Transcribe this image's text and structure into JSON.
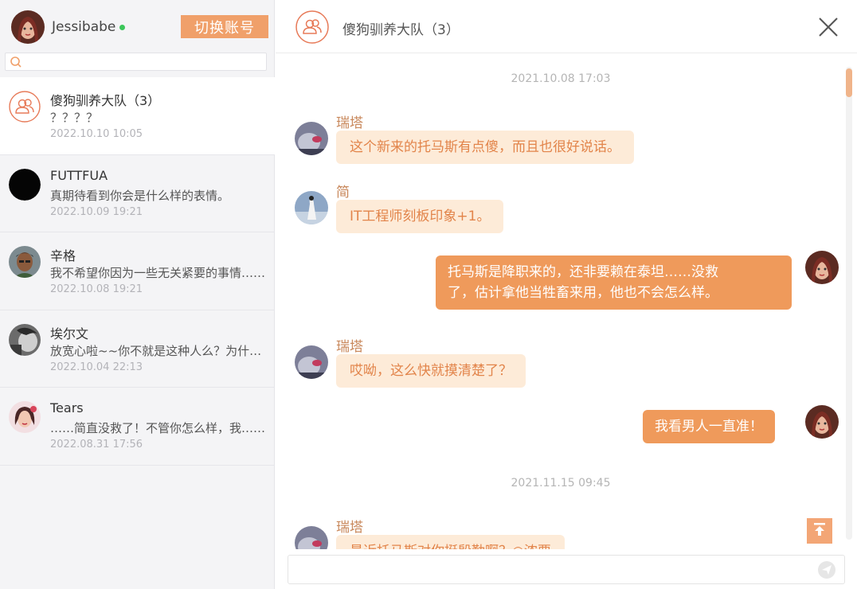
{
  "account": {
    "name": "Jessibabe",
    "switch_label": "切换账号"
  },
  "search": {
    "placeholder": ""
  },
  "conversations": [
    {
      "name": "傻狗驯养大队（3）",
      "last": "？？？？",
      "time": "2022.10.10 10:05"
    },
    {
      "name": "FUTTFUA",
      "last": "真期待看到你会是什么样的表情。",
      "time": "2022.10.09 19:21"
    },
    {
      "name": "辛格",
      "last": "我不希望你因为一些无关紧要的事情……",
      "time": "2022.10.08 19:21"
    },
    {
      "name": "埃尔文",
      "last": "放宽心啦~~你不就是这种人么？为什么……",
      "time": "2022.10.04 22:13"
    },
    {
      "name": "Tears",
      "last": "……简直没救了！不管你怎么样，我……",
      "time": "2022.08.31 17:56"
    }
  ],
  "chat": {
    "title": "傻狗驯养大队（3）",
    "timestamps": [
      "2021.10.08 17:03",
      "2021.11.15 09:45"
    ],
    "messages": [
      {
        "sender": "瑞塔",
        "text": "这个新来的托马斯有点傻，而且也很好说话。"
      },
      {
        "sender": "简",
        "text": "IT工程师刻板印象+1。"
      },
      {
        "sender": "me",
        "line1": "托马斯是降职来的，还非要赖在泰坦……没救",
        "line2": "了，估计拿他当牲畜来用，他也不会怎么样。"
      },
      {
        "sender": "瑞塔",
        "text": "哎呦，这么快就摸清楚了？"
      },
      {
        "sender": "me",
        "text": "我看男人一直准！"
      },
      {
        "sender": "瑞塔",
        "text": "最近托马斯对你挺殷勤啊？◎浓要"
      }
    ]
  },
  "colors": {
    "accent": "#ef9a5b",
    "bubble_in_bg": "#fdebd8",
    "bubble_in_text": "#e2844a",
    "sender_name": "#c8875a",
    "online": "#3cc65a"
  },
  "icons": [
    "search-icon",
    "group-icon",
    "close-icon",
    "scroll-to-top-icon",
    "send-icon"
  ]
}
